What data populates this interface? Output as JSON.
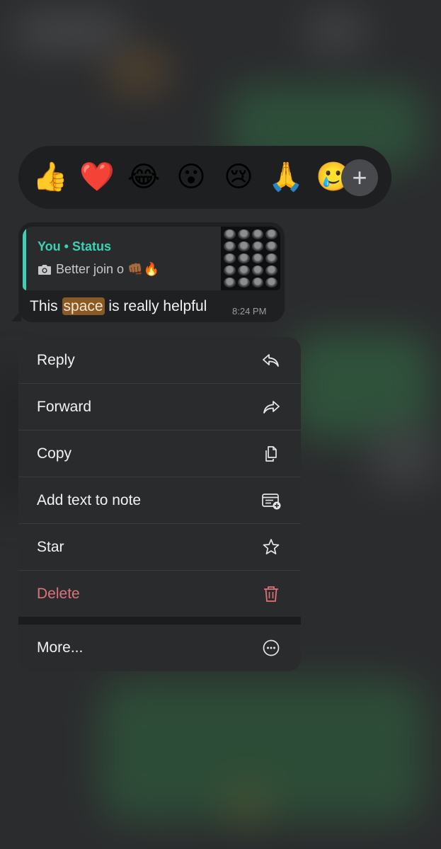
{
  "reactions": {
    "emojis": [
      "👍",
      "❤️",
      "😂",
      "😮",
      "😢",
      "🙏",
      "🥲"
    ],
    "add_icon": "plus-icon",
    "add_label": "+"
  },
  "message": {
    "quote_title": "You • Status",
    "quote_icon": "camera-icon",
    "quote_text": "Better join o 👊🏾🔥",
    "text_before": "This ",
    "text_highlight": "space",
    "text_after": " is really helpful",
    "time": "8:24 PM"
  },
  "menu": {
    "items": [
      {
        "label": "Reply",
        "icon": "reply-icon"
      },
      {
        "label": "Forward",
        "icon": "forward-icon"
      },
      {
        "label": "Copy",
        "icon": "copy-icon"
      },
      {
        "label": "Add text to note",
        "icon": "add-note-icon"
      },
      {
        "label": "Star",
        "icon": "star-icon"
      },
      {
        "label": "Delete",
        "icon": "trash-icon"
      },
      {
        "label": "More...",
        "icon": "more-icon"
      }
    ]
  },
  "colors": {
    "accent": "#3fd0b3",
    "danger": "#e0707c",
    "highlight": "#8a5a26"
  }
}
